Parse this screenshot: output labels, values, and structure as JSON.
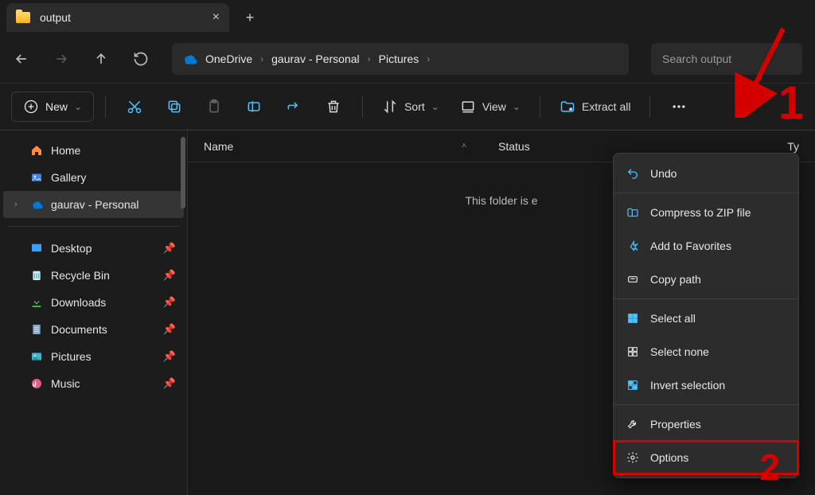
{
  "tab": {
    "title": "output"
  },
  "breadcrumbs": {
    "items": [
      "OneDrive",
      "gaurav - Personal",
      "Pictures"
    ]
  },
  "search": {
    "placeholder": "Search output"
  },
  "toolbar": {
    "new_label": "New",
    "sort_label": "Sort",
    "view_label": "View",
    "extract_label": "Extract all"
  },
  "sidebar": {
    "top": [
      {
        "label": "Home",
        "icon": "home"
      },
      {
        "label": "Gallery",
        "icon": "gallery"
      },
      {
        "label": "gaurav - Personal",
        "icon": "onedrive",
        "selected": true,
        "expandable": true
      }
    ],
    "pinned": [
      {
        "label": "Desktop",
        "icon": "desktop"
      },
      {
        "label": "Recycle Bin",
        "icon": "recycle"
      },
      {
        "label": "Downloads",
        "icon": "downloads"
      },
      {
        "label": "Documents",
        "icon": "documents"
      },
      {
        "label": "Pictures",
        "icon": "pictures"
      },
      {
        "label": "Music",
        "icon": "music"
      }
    ]
  },
  "columns": {
    "name": "Name",
    "status": "Status",
    "type": "Ty"
  },
  "empty_text": "This folder is e",
  "dropdown": {
    "groups": [
      [
        {
          "label": "Undo",
          "icon": "undo"
        }
      ],
      [
        {
          "label": "Compress to ZIP file",
          "icon": "zip"
        },
        {
          "label": "Add to Favorites",
          "icon": "star"
        },
        {
          "label": "Copy path",
          "icon": "copypath"
        }
      ],
      [
        {
          "label": "Select all",
          "icon": "selectall"
        },
        {
          "label": "Select none",
          "icon": "selectnone"
        },
        {
          "label": "Invert selection",
          "icon": "invert"
        }
      ],
      [
        {
          "label": "Properties",
          "icon": "wrench"
        },
        {
          "label": "Options",
          "icon": "gear",
          "highlight": true
        }
      ]
    ]
  },
  "annotations": {
    "one": "1",
    "two": "2"
  }
}
